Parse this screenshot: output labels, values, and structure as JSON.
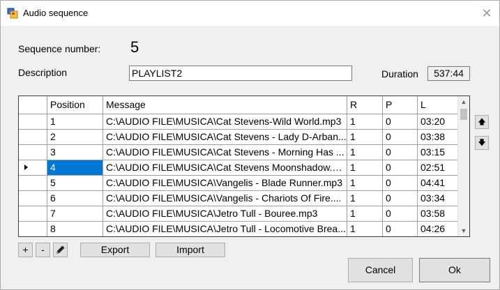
{
  "window": {
    "title": "Audio sequence",
    "close_glyph": "✕"
  },
  "form": {
    "sequence_label": "Sequence number:",
    "sequence_value": "5",
    "description_label": "Description",
    "description_value": "PLAYLIST2",
    "duration_label": "Duration",
    "duration_value": "537:44"
  },
  "grid": {
    "columns": [
      "Position",
      "Message",
      "R",
      "P",
      "L"
    ],
    "rows": [
      {
        "position": "1",
        "message": "C:\\AUDIO FILE\\MUSICA\\Cat Stevens-Wild World.mp3",
        "r": "1",
        "p": "0",
        "l": "03:20"
      },
      {
        "position": "2",
        "message": "C:\\AUDIO FILE\\MUSICA\\Cat Stevens - Lady D-Arban...",
        "r": "1",
        "p": "0",
        "l": "03:38"
      },
      {
        "position": "3",
        "message": "C:\\AUDIO FILE\\MUSICA\\Cat Stevens - Morning Has ...",
        "r": "1",
        "p": "0",
        "l": "03:15"
      },
      {
        "position": "4",
        "message": "C:\\AUDIO FILE\\MUSICA\\Cat Stevens Moonshadow.m...",
        "r": "1",
        "p": "0",
        "l": "02:51"
      },
      {
        "position": "5",
        "message": "C:\\AUDIO FILE\\MUSICA\\Vangelis - Blade Runner.mp3",
        "r": "1",
        "p": "0",
        "l": "04:41"
      },
      {
        "position": "6",
        "message": "C:\\AUDIO FILE\\MUSICA\\Vangelis - Chariots Of Fire....",
        "r": "1",
        "p": "0",
        "l": "03:34"
      },
      {
        "position": "7",
        "message": "C:\\AUDIO FILE\\MUSICA\\Jetro Tull - Bouree.mp3",
        "r": "1",
        "p": "0",
        "l": "03:58"
      },
      {
        "position": "8",
        "message": "C:\\AUDIO FILE\\MUSICA\\Jetro Tull - Locomotive Brea...",
        "r": "1",
        "p": "0",
        "l": "04:26"
      }
    ],
    "selected_row_index": 3
  },
  "buttons": {
    "add": "+",
    "remove": "-",
    "export": "Export",
    "import": "Import",
    "cancel": "Cancel",
    "ok": "Ok",
    "move_up_glyph": "🡅",
    "move_down_glyph": "🡇"
  },
  "colors": {
    "selection": "#0078d7",
    "window_bg": "#f0f0f0",
    "button_bg": "#e1e1e1"
  },
  "icons": {
    "app": "app-window-icon",
    "edit": "pencil-icon",
    "move_up": "arrow-up-icon",
    "move_down": "arrow-down-icon",
    "row_indicator": "row-pointer-icon"
  }
}
